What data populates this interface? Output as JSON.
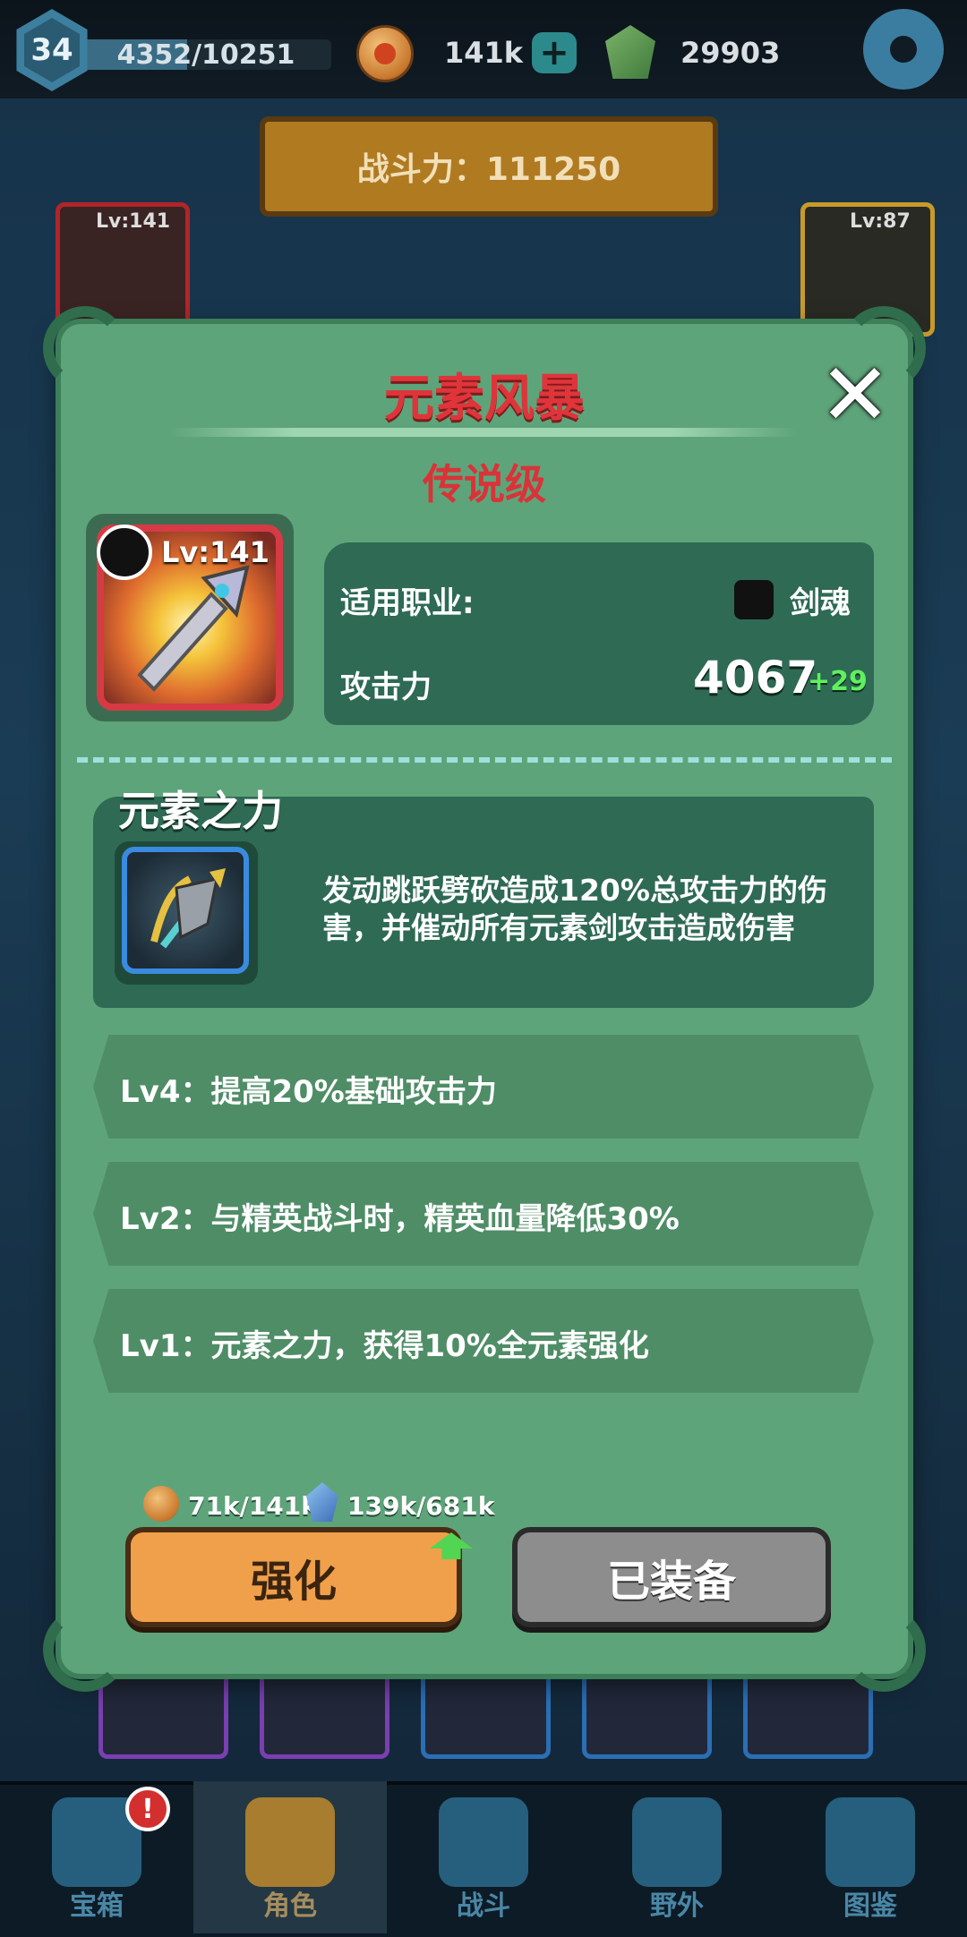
{
  "topbar": {
    "level": "34",
    "xp_text": "4352/10251",
    "xp_progress": 0.4245,
    "coins": "141k",
    "gems": "29903"
  },
  "scene": {
    "power_label": "战斗力：111250",
    "card_left_level": "Lv:141",
    "card_right_level": "Lv:87"
  },
  "modal": {
    "title": "元素风暴",
    "rarity": "传说级",
    "item_level": "Lv:141",
    "class_label": "适用职业:",
    "class_value": "剑魂",
    "attack_label": "攻击力",
    "attack_value": "4067",
    "attack_bonus": "+29",
    "skill": {
      "name": "元素之力",
      "description": "发动跳跃劈砍造成120%总攻击力的伤害，并催动所有元素剑攻击造成伤害"
    },
    "levels": [
      {
        "text": "Lv4：提高20%基础攻击力"
      },
      {
        "text": "Lv2：与精英战斗时，精英血量降低30%"
      },
      {
        "text": "Lv1：元素之力，获得10%全元素强化"
      }
    ],
    "cost_coins": "71k/141k",
    "cost_shards": "139k/681k",
    "upgrade_label": "强化",
    "equipped_label": "已装备"
  },
  "nav": {
    "items": [
      {
        "label": "宝箱"
      },
      {
        "label": "角色"
      },
      {
        "label": "战斗"
      },
      {
        "label": "野外"
      },
      {
        "label": "图鉴"
      }
    ],
    "alert": "!"
  },
  "colors": {
    "modal_bg": "#5ea47a",
    "title_red": "#e0343b",
    "upgrade_orange": "#f0a04a",
    "bonus_green": "#5ef05e"
  }
}
